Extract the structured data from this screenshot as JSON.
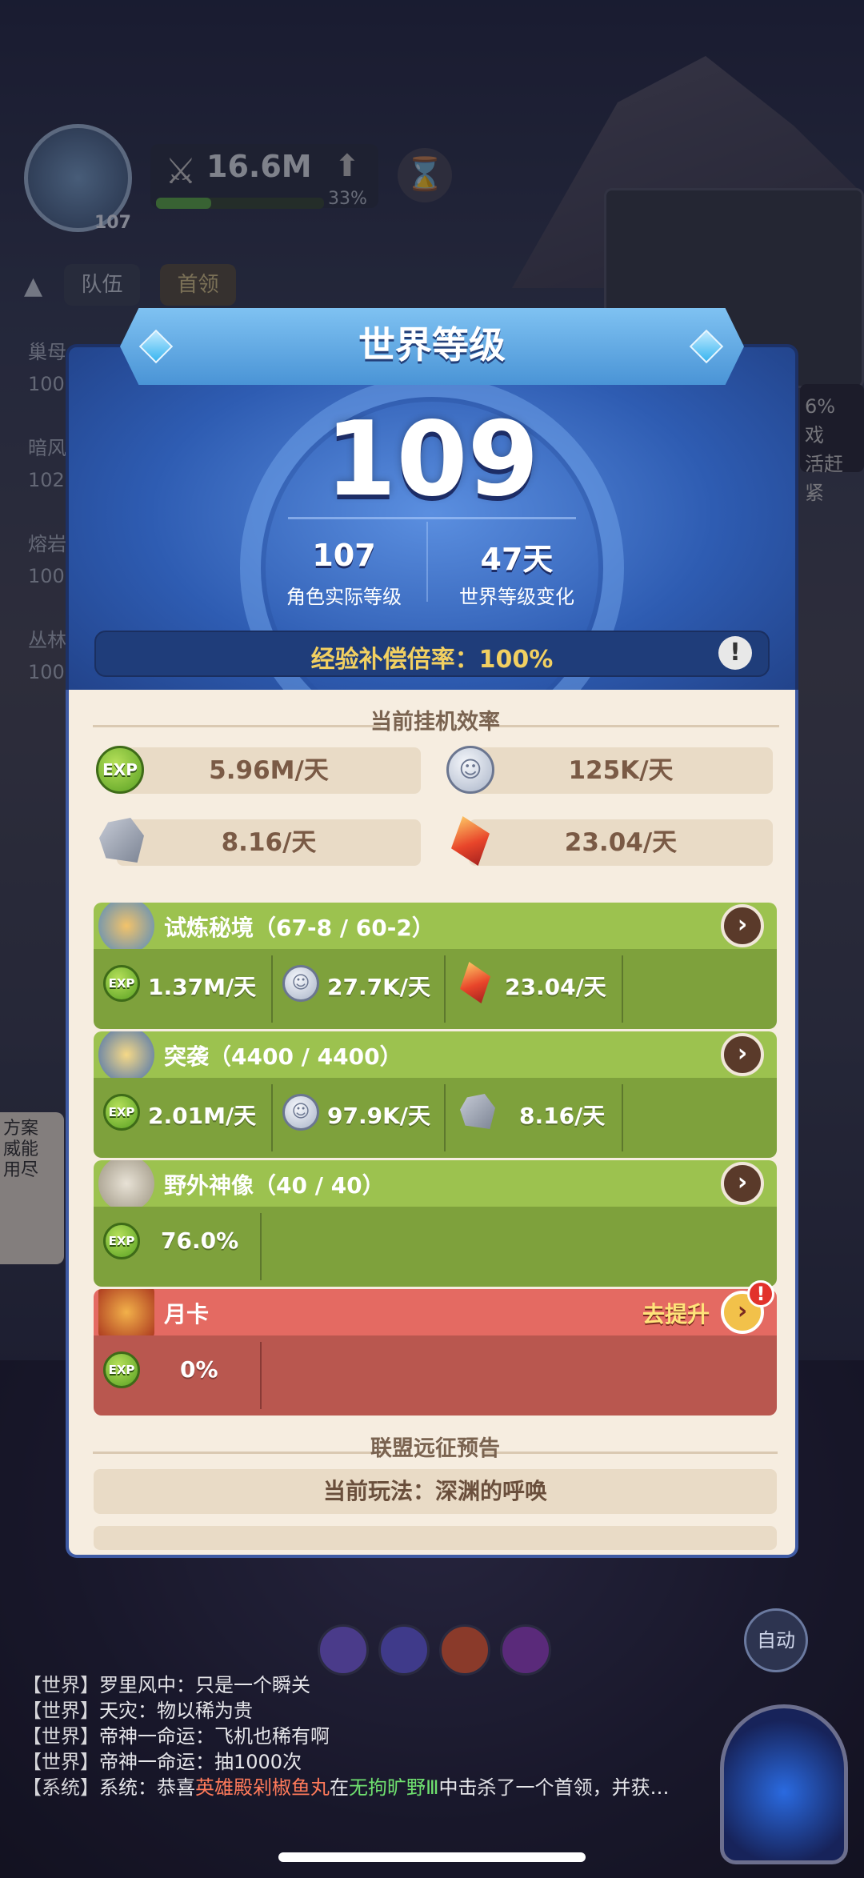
{
  "hud": {
    "avatar_level": "107",
    "power": "16.6M",
    "power_progress_pct": 33,
    "power_pct_label": "33%",
    "team_label": "队伍",
    "boss_label": "首领",
    "side_list": [
      "巢母",
      "100",
      "暗风",
      "102",
      "熔岩",
      "100",
      "丛林",
      "100"
    ]
  },
  "right_cut": [
    "6%",
    "戏",
    "活赶紧"
  ],
  "left_widget": [
    "方案",
    "威能",
    "用尽"
  ],
  "dialog": {
    "title": "世界等级",
    "world_level": "109",
    "actual_level_value": "107",
    "actual_level_label": "角色实际等级",
    "change_value": "47天",
    "change_label": "世界等级变化",
    "exp_rate_text": "经验补偿倍率：100%",
    "efficiency_title": "当前挂机效率",
    "rates": {
      "exp": "5.96M/天",
      "coin": "125K/天",
      "stone": "8.16/天",
      "crystal": "23.04/天"
    },
    "cards": [
      {
        "title": "试炼秘境（67-8 / 60-2）",
        "cells": [
          {
            "icon": "exp",
            "text": "1.37M/天"
          },
          {
            "icon": "coin",
            "text": "27.7K/天"
          },
          {
            "icon": "crystal",
            "text": "23.04/天"
          }
        ]
      },
      {
        "title": "突袭（4400 / 4400）",
        "cells": [
          {
            "icon": "exp",
            "text": "2.01M/天"
          },
          {
            "icon": "coin",
            "text": "97.9K/天"
          },
          {
            "icon": "stone",
            "text": "8.16/天"
          }
        ]
      },
      {
        "title": "野外神像（40 / 40）",
        "cells": [
          {
            "icon": "exp",
            "text": "76.0%"
          }
        ]
      },
      {
        "title": "月卡",
        "upgrade_label": "去提升",
        "cells": [
          {
            "icon": "exp",
            "text": "0%"
          }
        ]
      }
    ],
    "alliance_title": "联盟远征预告",
    "current_mode": "当前玩法：深渊的呼唤",
    "exp_icon_text": "EXP"
  },
  "chat": [
    {
      "tag": "【世界】",
      "text": "罗里风中：只是一个瞬关"
    },
    {
      "tag": "【世界】",
      "text": "天灾：物以稀为贵"
    },
    {
      "tag": "【世界】",
      "text": "帝神一命运：飞机也稀有啊"
    },
    {
      "tag": "【世界】",
      "text": "帝神一命运：抽1000次"
    },
    {
      "tag": "【系统】",
      "prefix": "系统：恭喜",
      "player": "英雄殿剁椒鱼丸",
      "mid": "在",
      "place": "无拘旷野Ⅲ",
      "suffix": "中击杀了一个首领，并获…"
    }
  ],
  "auto_label": "自动",
  "colors": {
    "panel_blue": "#2e5cb2",
    "panel_cream": "#f6ede0",
    "card_green": "#9cc24f",
    "card_red": "#e46a62",
    "gold_text": "#f2d061"
  }
}
